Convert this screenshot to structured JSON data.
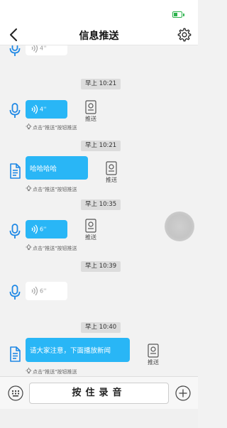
{
  "app": {
    "title": "信息推送"
  },
  "messages": [
    {
      "type": "voice",
      "duration": "4''",
      "partial": true
    },
    {
      "time": "早上 10:21",
      "type": "voice",
      "duration": "4''",
      "pushed": false
    },
    {
      "time": "早上 10:21",
      "type": "text",
      "text": "哈哈哈哈",
      "pushed": false
    },
    {
      "time": "早上 10:35",
      "type": "voice",
      "duration": "6''",
      "pushed": false
    },
    {
      "time": "早上 10:39",
      "type": "voice",
      "duration": "6''",
      "pushed": true
    },
    {
      "time": "早上 10:40",
      "type": "text",
      "text": "请大家注意，下面播放新闻",
      "pushed": false
    }
  ],
  "labels": {
    "push_button": "推送",
    "push_hint": "点击\"推送\"按钮推送"
  },
  "input_bar": {
    "record_label": "按住录音"
  },
  "colors": {
    "accent": "#29b6f6",
    "battery": "#2bb24c",
    "icon": "#1e88e5"
  }
}
